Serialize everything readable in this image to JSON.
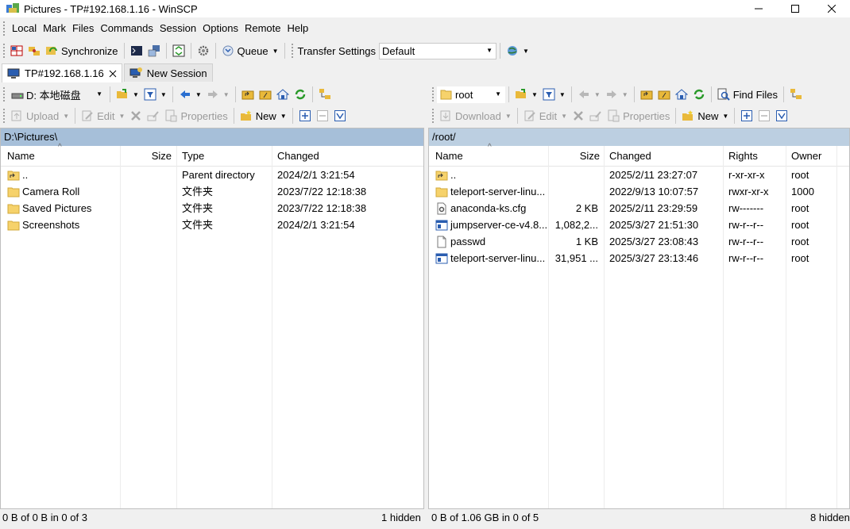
{
  "window": {
    "title": "Pictures - TP#192.168.1.16 - WinSCP"
  },
  "menu": [
    "Local",
    "Mark",
    "Files",
    "Commands",
    "Session",
    "Options",
    "Remote",
    "Help"
  ],
  "toolbar": {
    "synchronize": "Synchronize",
    "queue": "Queue",
    "transfer_settings_label": "Transfer Settings",
    "transfer_settings_value": "Default"
  },
  "tabs": [
    {
      "label": "TP#192.168.1.16"
    },
    {
      "label": "New Session"
    }
  ],
  "local": {
    "drive": "D: 本地磁盘",
    "buttons": {
      "upload": "Upload",
      "edit": "Edit",
      "properties": "Properties",
      "new": "New"
    },
    "path": "D:\\Pictures\\",
    "columns": [
      "Name",
      "Size",
      "Type",
      "Changed"
    ],
    "rows": [
      {
        "name": "..",
        "size": "",
        "type": "Parent directory",
        "changed": "2024/2/1   3:21:54",
        "icon": "parent-folder-icon"
      },
      {
        "name": "Camera Roll",
        "size": "",
        "type": "文件夹",
        "changed": "2023/7/22  12:18:38",
        "icon": "folder-icon"
      },
      {
        "name": "Saved Pictures",
        "size": "",
        "type": "文件夹",
        "changed": "2023/7/22  12:18:38",
        "icon": "folder-icon"
      },
      {
        "name": "Screenshots",
        "size": "",
        "type": "文件夹",
        "changed": "2024/2/1   3:21:54",
        "icon": "folder-icon"
      }
    ],
    "status": "0 B of 0 B in 0 of 3",
    "hidden": "1 hidden"
  },
  "remote": {
    "directory": "root",
    "buttons": {
      "download": "Download",
      "edit": "Edit",
      "properties": "Properties",
      "new": "New",
      "find_files": "Find Files"
    },
    "path": "/root/",
    "columns": [
      "Name",
      "Size",
      "Changed",
      "Rights",
      "Owner"
    ],
    "rows": [
      {
        "name": "..",
        "size": "",
        "changed": "2025/2/11 23:27:07",
        "rights": "r-xr-xr-x",
        "owner": "root",
        "icon": "parent-folder-icon"
      },
      {
        "name": "teleport-server-linu...",
        "size": "",
        "changed": "2022/9/13 10:07:57",
        "rights": "rwxr-xr-x",
        "owner": "1000",
        "icon": "folder-icon"
      },
      {
        "name": "anaconda-ks.cfg",
        "size": "2 KB",
        "changed": "2025/2/11 23:29:59",
        "rights": "rw-------",
        "owner": "root",
        "icon": "config-file-icon"
      },
      {
        "name": "jumpserver-ce-v4.8....",
        "size": "1,082,2...",
        "changed": "2025/3/27 21:51:30",
        "rights": "rw-r--r--",
        "owner": "root",
        "icon": "archive-file-icon"
      },
      {
        "name": "passwd",
        "size": "1 KB",
        "changed": "2025/3/27 23:08:43",
        "rights": "rw-r--r--",
        "owner": "root",
        "icon": "file-icon"
      },
      {
        "name": "teleport-server-linu...",
        "size": "31,951 ...",
        "changed": "2025/3/27 23:13:46",
        "rights": "rw-r--r--",
        "owner": "root",
        "icon": "archive-file-icon"
      }
    ],
    "status": "0 B of 1.06 GB in 0 of 5",
    "hidden": "8 hidden"
  },
  "colors": {
    "local_path_bg": "#a6bfd9",
    "remote_path_bg": "#bccfe1",
    "folder": "#f6d26b"
  }
}
